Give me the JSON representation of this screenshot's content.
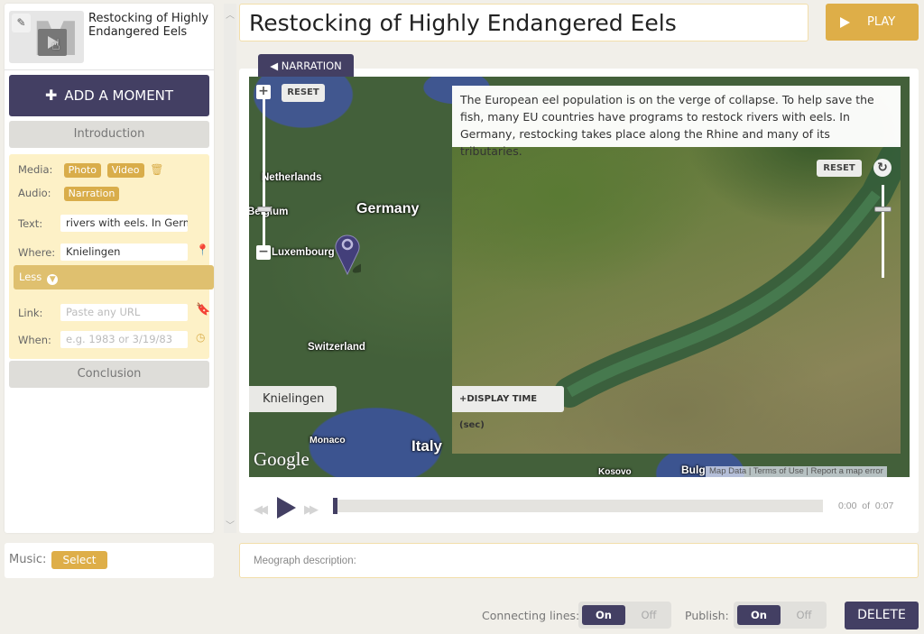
{
  "project": {
    "title": "Restocking of Highly Endangered Eels",
    "thumbnail_letter": "M"
  },
  "sidebar": {
    "add_moment_label": "ADD A MOMENT",
    "introduction_label": "Introduction",
    "conclusion_label": "Conclusion",
    "moment": {
      "media_label": "Media:",
      "media_tags": [
        "Photo",
        "Video"
      ],
      "audio_label": "Audio:",
      "audio_tags": [
        "Narration"
      ],
      "text_label": "Text:",
      "text_value": "rivers with eels. In Germ",
      "where_label": "Where:",
      "where_value": "Knielingen",
      "less_label": "Less",
      "link_label": "Link:",
      "link_placeholder": "Paste any URL",
      "when_label": "When:",
      "when_placeholder": "e.g. 1983 or 3/19/83"
    }
  },
  "header": {
    "title_value": "Restocking of Highly Endangered Eels",
    "play_label": "PLAY"
  },
  "stage": {
    "narration_tab_label": "NARRATION",
    "map_reset_label": "RESET",
    "map_labels": {
      "netherlands": "Netherlands",
      "belgium": "Belgium",
      "germany": "Germany",
      "luxembourg": "Luxembourg",
      "switzerland": "Switzerland",
      "monaco": "Monaco",
      "italy": "Italy",
      "kosovo": "Kosovo",
      "bulgaria_partial": "Bulg"
    },
    "location_label": "Knielingen",
    "google_logo": "Google",
    "caption": "The European eel population is on the verge of collapse. To help save the fish, many EU countries have programs to restock rivers with eels. In Germany, restocking takes place along the Rhine and many of its tributaries.",
    "photo_reset_label": "RESET",
    "display_time_label": "+DISPLAY TIME (sec)",
    "map_footer": {
      "map_data": "Map Data",
      "terms": "Terms of Use",
      "report": "Report a map error"
    }
  },
  "player": {
    "current_time": "0:00",
    "of_label": "of",
    "total_time": "0:07",
    "progress_fraction": 0
  },
  "bottom": {
    "music_label": "Music:",
    "music_select_label": "Select",
    "description_placeholder": "Meograph description:",
    "connecting_lines_label": "Connecting lines:",
    "connecting_lines_on": "On",
    "connecting_lines_off": "Off",
    "connecting_lines_state": "On",
    "publish_label": "Publish:",
    "publish_on": "On",
    "publish_off": "Off",
    "publish_state": "On",
    "delete_label": "DELETE"
  },
  "colors": {
    "primary": "#433f63",
    "accent": "#deae48",
    "moment_bg": "#fdf1c7",
    "page_bg": "#f1efe9"
  }
}
